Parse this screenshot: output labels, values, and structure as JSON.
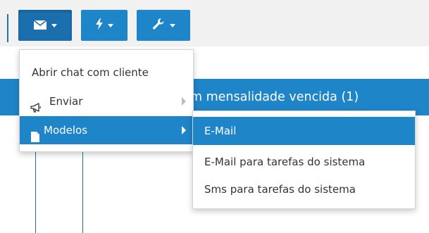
{
  "toolbar": {
    "buttons": [
      {
        "icon": "envelope-icon"
      },
      {
        "icon": "bolt-icon"
      },
      {
        "icon": "wrench-icon"
      }
    ]
  },
  "background": {
    "title_partial": "m mensalidade vencida (1)"
  },
  "menu": {
    "items": [
      {
        "label": "Abrir chat com cliente"
      },
      {
        "label": "Enviar",
        "icon": "megaphone-icon",
        "has_submenu": true
      },
      {
        "label": "Modelos",
        "icon": "document-icon",
        "has_submenu": true,
        "active": true
      }
    ]
  },
  "submenu": {
    "items": [
      {
        "label": "E-Mail",
        "active": true
      },
      {
        "label": "E-Mail para tarefas do sistema"
      },
      {
        "label": "Sms para tarefas do sistema"
      }
    ]
  },
  "colors": {
    "primary": "#1f85c9",
    "toolbar_bg": "#f1f1f1",
    "menu_border": "#d4d4d4"
  }
}
